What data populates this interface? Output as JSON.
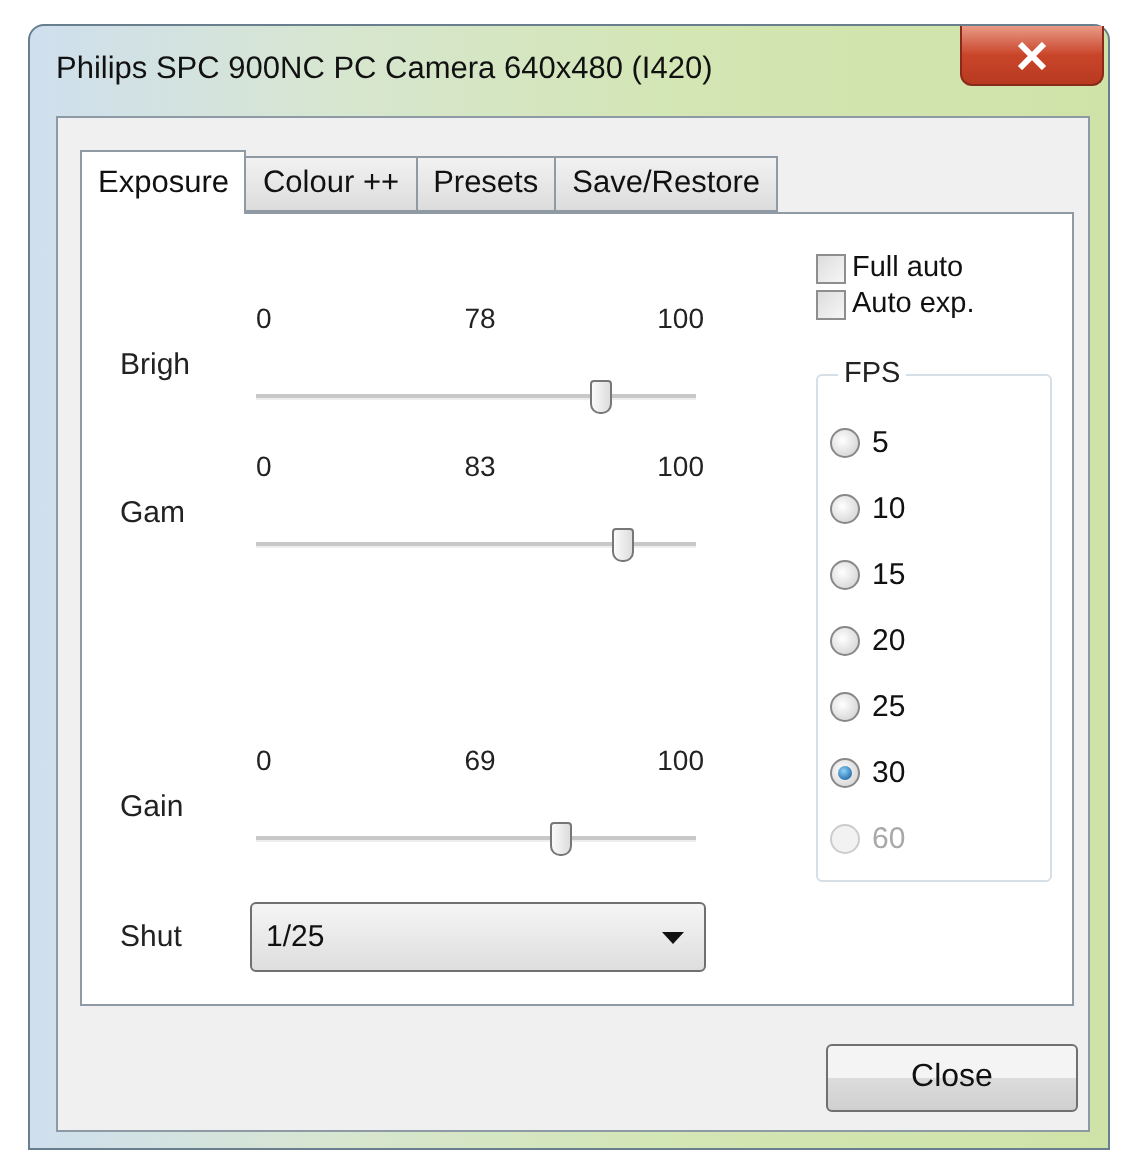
{
  "window": {
    "title": "Philips SPC 900NC PC Camera 640x480 (I420)"
  },
  "tabs": [
    {
      "label": "Exposure",
      "selected": true
    },
    {
      "label": "Colour ++",
      "selected": false
    },
    {
      "label": "Presets",
      "selected": false
    },
    {
      "label": "Save/Restore",
      "selected": false
    }
  ],
  "sliders": [
    {
      "label": "Brigh",
      "min": "0",
      "value": "78",
      "max": "100",
      "level": 0.78
    },
    {
      "label": "Gam",
      "min": "0",
      "value": "83",
      "max": "100",
      "level": 0.83
    },
    {
      "label": "Gain",
      "min": "0",
      "value": "69",
      "max": "100",
      "level": 0.69
    }
  ],
  "checks": [
    {
      "label": "Full auto",
      "checked": false
    },
    {
      "label": "Auto exp.",
      "checked": false
    }
  ],
  "fps": {
    "label": "FPS",
    "options": [
      {
        "label": "5",
        "selected": false,
        "disabled": false
      },
      {
        "label": "10",
        "selected": false,
        "disabled": false
      },
      {
        "label": "15",
        "selected": false,
        "disabled": false
      },
      {
        "label": "20",
        "selected": false,
        "disabled": false
      },
      {
        "label": "25",
        "selected": false,
        "disabled": false
      },
      {
        "label": "30",
        "selected": true,
        "disabled": false
      },
      {
        "label": "60",
        "selected": false,
        "disabled": true
      }
    ]
  },
  "shutter": {
    "label": "Shut",
    "value": "1/25"
  },
  "close_button": "Close"
}
